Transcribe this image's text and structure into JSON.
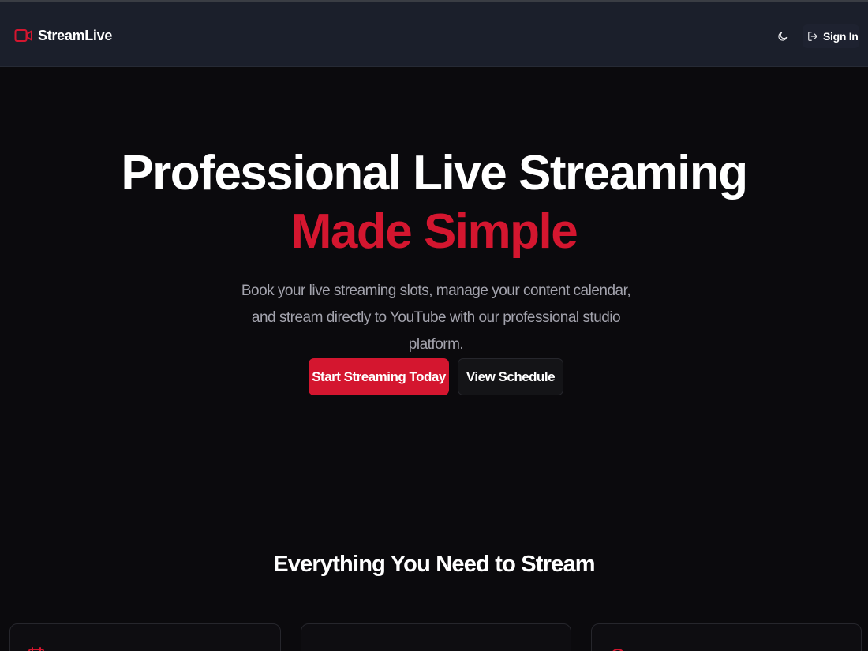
{
  "header": {
    "brand_name": "StreamLive",
    "brand_icon": "video-camera-icon",
    "theme_toggle_icon": "moon-icon",
    "sign_in_label": "Sign In",
    "sign_in_icon": "log-in-icon"
  },
  "hero": {
    "title_line1": "Professional Live Streaming",
    "title_line2": "Made Simple",
    "subtitle": "Book your live streaming slots, manage your content calendar, and stream directly to YouTube with our professional studio platform.",
    "primary_cta": "Start Streaming Today",
    "secondary_cta": "View Schedule"
  },
  "features": {
    "title": "Everything You Need to Stream",
    "cards": [
      {
        "icon": "feature-icon"
      },
      {
        "icon": "feature-icon"
      },
      {
        "icon": "feature-icon"
      }
    ]
  },
  "colors": {
    "accent": "#d4162f",
    "header_bg": "#1b1f2b",
    "page_bg": "#0b0a0d",
    "muted_text": "#a3a3ad"
  }
}
